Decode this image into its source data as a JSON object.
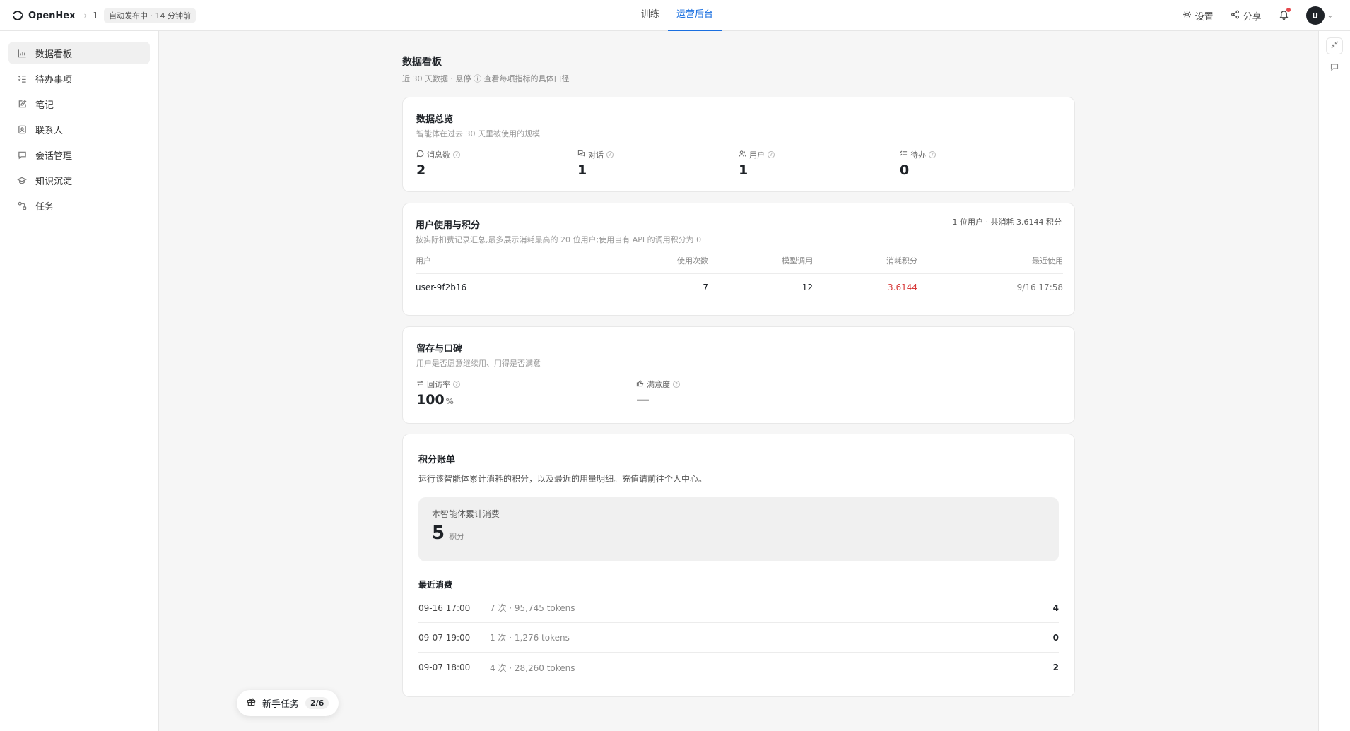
{
  "topbar": {
    "brand": "OpenHex",
    "crumb_sep": "›",
    "crumb_number": "1",
    "status": "自动发布中 · 14 分钟前",
    "tabs": [
      {
        "label": "训练",
        "active": false
      },
      {
        "label": "运营后台",
        "active": true
      }
    ],
    "settings_label": "设置",
    "share_label": "分享",
    "avatar_initial": "U"
  },
  "sidebar": {
    "items": [
      {
        "label": "数据看板",
        "icon": "bar-chart-icon",
        "active": true
      },
      {
        "label": "待办事项",
        "icon": "checklist-icon"
      },
      {
        "label": "笔记",
        "icon": "edit-note-icon"
      },
      {
        "label": "联系人",
        "icon": "contact-card-icon"
      },
      {
        "label": "会话管理",
        "icon": "chat-bubble-icon"
      },
      {
        "label": "知识沉淀",
        "icon": "graduation-cap-icon"
      },
      {
        "label": "任务",
        "icon": "workflow-icon"
      }
    ]
  },
  "page": {
    "title": "数据看板",
    "subtitle": "近 30 天数据 · 悬停 ⓘ 查看每项指标的具体口径"
  },
  "overview": {
    "title": "数据总览",
    "subtitle": "智能体在过去 30 天里被使用的规模",
    "stats": [
      {
        "label": "消息数",
        "value": "2",
        "icon": "message-icon"
      },
      {
        "label": "对话",
        "value": "1",
        "icon": "conversation-icon"
      },
      {
        "label": "用户",
        "value": "1",
        "icon": "users-icon"
      },
      {
        "label": "待办",
        "value": "0",
        "icon": "todo-icon"
      }
    ]
  },
  "usage": {
    "title": "用户使用与积分",
    "subtitle": "按实际扣费记录汇总,最多展示消耗最高的 20 位用户;使用自有 API 的调用积分为 0",
    "summary": "1 位用户 · 共消耗 3.6144 积分",
    "columns": [
      "用户",
      "使用次数",
      "模型调用",
      "消耗积分",
      "最近使用"
    ],
    "rows": [
      {
        "user": "user-9f2b16",
        "uses": "7",
        "model_calls": "12",
        "points": "3.6144",
        "last_used": "9/16 17:58"
      }
    ]
  },
  "retention": {
    "title": "留存与口碑",
    "subtitle": "用户是否愿意继续用、用得是否满意",
    "return_label": "回访率",
    "return_value": "100",
    "return_unit": "%",
    "satisfaction_label": "满意度",
    "satisfaction_value": "—"
  },
  "billing": {
    "title": "积分账单",
    "subtitle": "运行该智能体累计消耗的积分，以及最近的用量明细。充值请前往个人中心。",
    "total_label": "本智能体累计消费",
    "total_value": "5",
    "total_unit": "积分",
    "recent_title": "最近消费",
    "recent": [
      {
        "time": "09-16 17:00",
        "detail": "7 次 · 95,745 tokens",
        "amount": "4"
      },
      {
        "time": "09-07 19:00",
        "detail": "1 次 · 1,276 tokens",
        "amount": "0"
      },
      {
        "time": "09-07 18:00",
        "detail": "4 次 · 28,260 tokens",
        "amount": "2"
      }
    ]
  },
  "onboarding": {
    "label": "新手任务",
    "progress": "2/6"
  },
  "colors": {
    "accent": "#1a6fe0",
    "points_red": "#d73a3a",
    "notification_dot": "#e5484d"
  }
}
